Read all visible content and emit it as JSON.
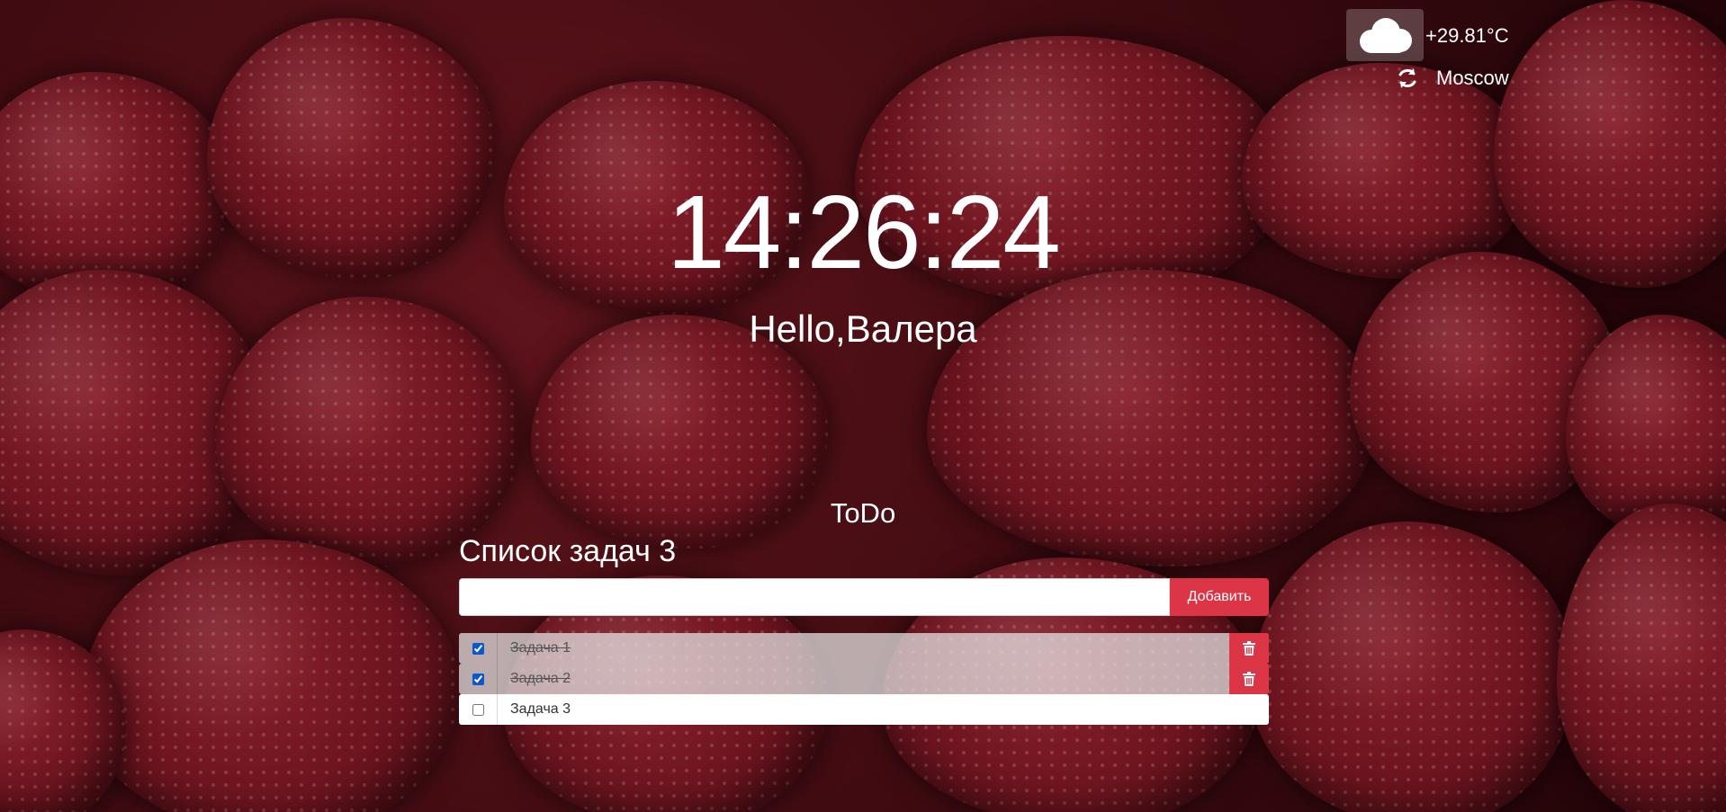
{
  "weather": {
    "icon": "cloud-icon",
    "temperature": "+29.81°C",
    "city": "Moscow"
  },
  "clock": {
    "time": "14:26:24"
  },
  "greeting": {
    "text": "Hello,Валера"
  },
  "todo": {
    "heading": "ToDo",
    "list_title": "Список задач 3",
    "input_value": "",
    "add_label": "Добавить",
    "tasks": [
      {
        "label": "Задача 1",
        "done": true
      },
      {
        "label": "Задача 2",
        "done": true
      },
      {
        "label": "Задача 3",
        "done": false
      }
    ]
  },
  "colors": {
    "accent_danger": "#dc3545",
    "text_light": "#ffffff"
  }
}
